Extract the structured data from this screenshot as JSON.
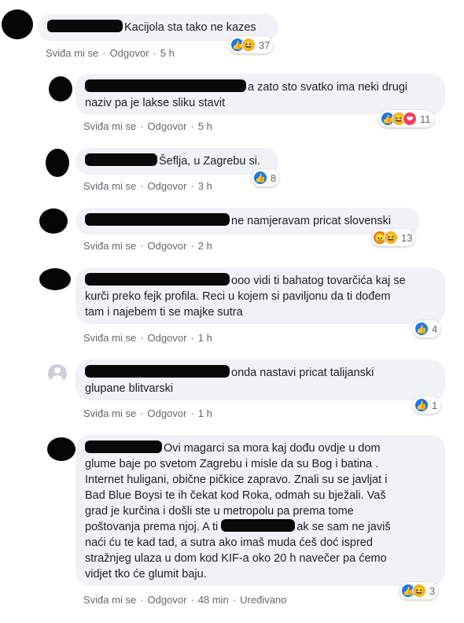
{
  "actions": {
    "like": "Sviđa mi se",
    "reply": "Odgovor",
    "edited": "Uređivano"
  },
  "comments": [
    {
      "text": "Kacijola sta tako ne kazes",
      "time": "5 h",
      "reaction_count": "37",
      "reactions": [
        "like-icon",
        "haha-icon"
      ]
    },
    {
      "text_line1": "a zato sto svatko ima neki drugi",
      "text_line2": "naziv pa je lakse sliku stavit",
      "time": "5 h",
      "reaction_count": "11",
      "reactions": [
        "like-icon",
        "haha-icon",
        "love-icon"
      ]
    },
    {
      "text": "Šeflja, u Zagrebu si.",
      "time": "3 h",
      "reaction_count": "8",
      "reactions": [
        "like-icon"
      ]
    },
    {
      "text": "ne namjeravam pricat slovenski",
      "time": "2 h",
      "reaction_count": "13",
      "reactions": [
        "angry-icon",
        "haha-icon"
      ]
    },
    {
      "text_line1": "ooo vidi ti bahatog tovarčića kaj se",
      "text_line2": "kurči preko fejk profila. Reci u kojem si paviljonu da ti dođem",
      "text_line3": "tam i najebem ti se majke sutra",
      "time": "1 h",
      "reaction_count": "4",
      "reactions": [
        "like-icon"
      ]
    },
    {
      "text_line1": "onda nastavi pricat talijanski",
      "text_line2": "glupane blitvarski",
      "time": "1 h",
      "reaction_count": "1",
      "reactions": [
        "like-icon"
      ]
    },
    {
      "text_line1": "Ovi magarci sa mora kaj dođu ovdje u dom",
      "text_line2": "glume baje po svetom Zagrebu i misle da su Bog i batina .",
      "text_line3": "Internet huligani, obične pičkice zapravo. Znali su se javljat i",
      "text_line4": "Bad Blue Boysi te ih čekat kod Roka, odmah su bježali. Vaš",
      "text_line5": "grad je kurčina i došli ste u metropolu pa prema tome",
      "text_line6": "poštovanja prema njoj. A ti",
      "text_line6b": "ak se sam ne javiš",
      "text_line7": "naći ću te kad tad, a sutra ako imaš muda ćeš doć ispred",
      "text_line8": "stražnjeg ulaza u dom kod KIF-a oko 20 h navečer pa ćemo",
      "text_line9": "vidjet tko će glumit baju.",
      "time": "48 min",
      "reaction_count": "3",
      "reactions": [
        "like-icon",
        "haha-icon"
      ]
    }
  ],
  "colors": {
    "like": "#1877f2",
    "haha": "#f7b125",
    "angry": "#e9710f",
    "love": "#f33e58",
    "bubble": "#f0f2f5",
    "meta": "#65676b"
  }
}
